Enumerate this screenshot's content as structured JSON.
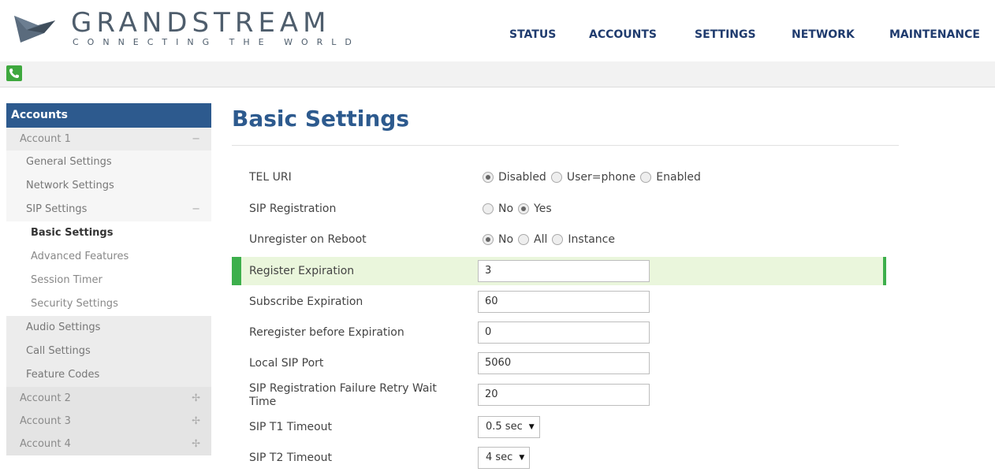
{
  "brand": {
    "name": "GRANDSTREAM",
    "tagline": "CONNECTING THE WORLD",
    "color": "#4e5d6c"
  },
  "nav": {
    "items": [
      "STATUS",
      "ACCOUNTS",
      "SETTINGS",
      "NETWORK",
      "MAINTENANCE"
    ]
  },
  "toolbar": {
    "phone_icon": "phone-icon",
    "accent": "#3ea83e"
  },
  "sidebar": {
    "header": "Accounts",
    "items": [
      {
        "label": "Account 1",
        "toggle": "−"
      },
      {
        "label": "General Settings"
      },
      {
        "label": "Network Settings"
      },
      {
        "label": "SIP Settings",
        "toggle": "−"
      },
      {
        "label": "Basic Settings"
      },
      {
        "label": "Advanced Features"
      },
      {
        "label": "Session Timer"
      },
      {
        "label": "Security Settings"
      },
      {
        "label": "Audio Settings"
      },
      {
        "label": "Call Settings"
      },
      {
        "label": "Feature Codes"
      },
      {
        "label": "Account 2",
        "toggle": "✢"
      },
      {
        "label": "Account 3",
        "toggle": "✢"
      },
      {
        "label": "Account 4",
        "toggle": "✢"
      }
    ]
  },
  "main": {
    "title": "Basic Settings",
    "rows": [
      {
        "label": "TEL URI",
        "options": [
          "Disabled",
          "User=phone",
          "Enabled"
        ],
        "selected": "Disabled"
      },
      {
        "label": "SIP Registration",
        "options": [
          "No",
          "Yes"
        ],
        "selected": "Yes"
      },
      {
        "label": "Unregister on Reboot",
        "options": [
          "No",
          "All",
          "Instance"
        ],
        "selected": "No"
      },
      {
        "label": "Register Expiration",
        "value": "3"
      },
      {
        "label": "Subscribe Expiration",
        "value": "60"
      },
      {
        "label": "Reregister before Expiration",
        "value": "0"
      },
      {
        "label": "Local SIP Port",
        "value": "5060"
      },
      {
        "label": "SIP Registration Failure Retry Wait Time",
        "value": "20"
      },
      {
        "label": "SIP T1 Timeout",
        "select": "0.5 sec"
      },
      {
        "label": "SIP T2 Timeout",
        "select": "4 sec"
      }
    ]
  },
  "colors": {
    "accent_blue": "#2d5a8e",
    "highlight_green": "#3daf4c",
    "highlight_bg": "#eaf6dc"
  }
}
